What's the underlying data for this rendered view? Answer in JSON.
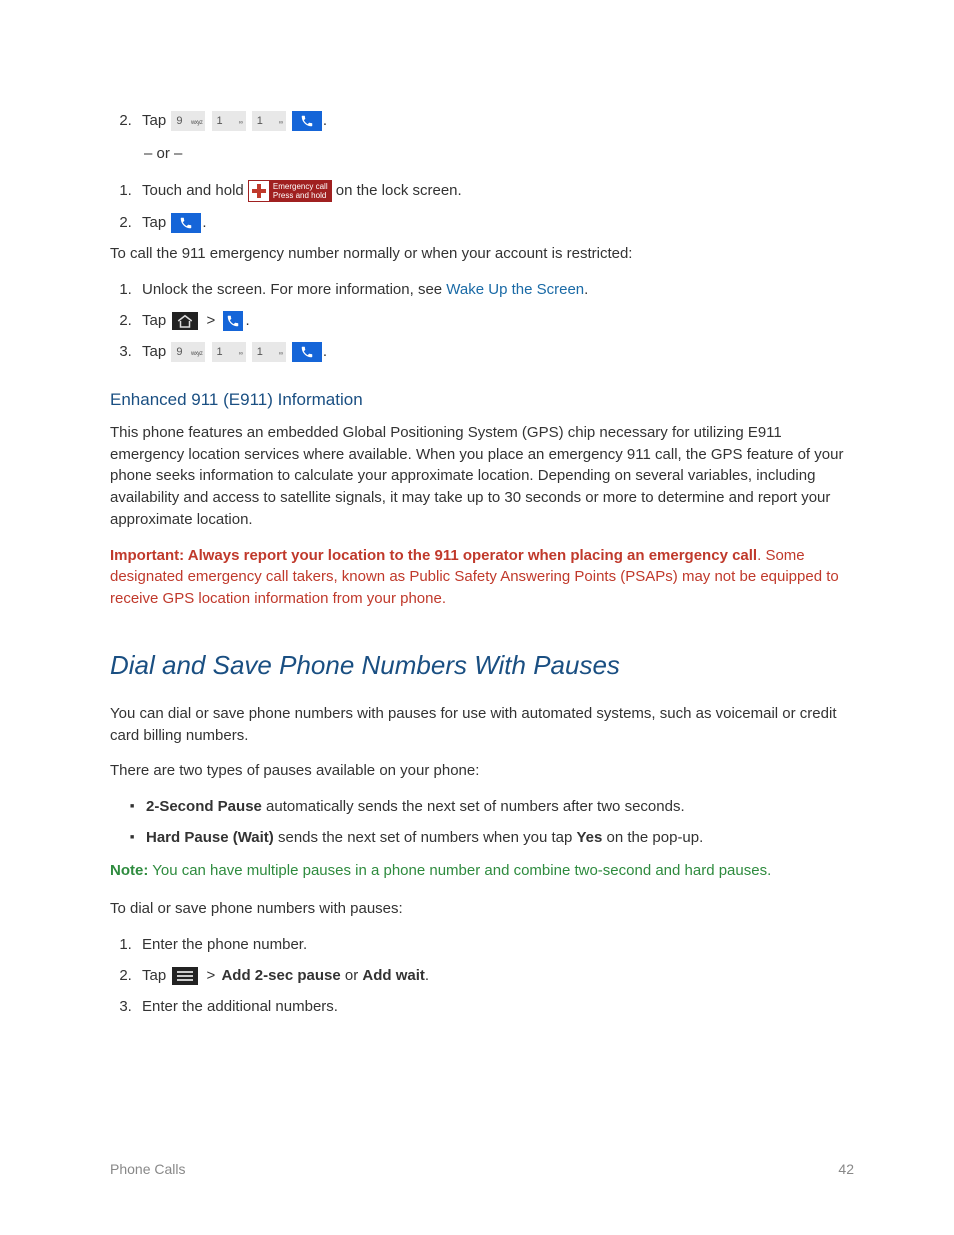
{
  "list1": {
    "item2_pre": "Tap ",
    "item2_post": "."
  },
  "or_text": "– or –",
  "list2": {
    "item1_pre": "Touch and hold ",
    "item1_post": " on the lock screen.",
    "emergency_top": "Emergency call",
    "emergency_bottom": "Press and hold",
    "item2_pre": "Tap ",
    "item2_post": "."
  },
  "para_restricted": "To call the 911 emergency number normally or when your account is restricted:",
  "list3": {
    "item1_pre": "Unlock the screen. For more information, see ",
    "item1_link": "Wake Up the Screen",
    "item1_post": ".",
    "item2_pre": "Tap ",
    "item2_gt": " > ",
    "item2_post": ".",
    "item3_pre": "Tap ",
    "item3_post": "."
  },
  "keys": {
    "k9": "9",
    "k9sup": "wxyz",
    "k1": "1",
    "k1sup": "∞"
  },
  "e911_heading": "Enhanced 911 (E911) Information",
  "e911_para": "This phone features an embedded Global Positioning System (GPS) chip necessary for utilizing E911 emergency location services where available. When you place an emergency 911 call, the GPS feature of your phone seeks information to calculate your approximate location. Depending on several variables, including availability and access to satellite signals, it may take up to 30 seconds or more to determine and report your approximate location.",
  "important_lead": "Important: Always report your location to the 911 operator when placing an emergency call",
  "important_tail": ". Some designated emergency call takers, known as Public Safety Answering Points (PSAPs) may not be equipped to receive GPS location information from your phone.",
  "pauses_heading": "Dial and Save Phone Numbers With Pauses",
  "pauses_para1": "You can dial or save phone numbers with pauses for use with automated systems, such as voicemail or credit card billing numbers.",
  "pauses_para2": "There are two types of pauses available on your phone:",
  "bullets": {
    "b1_bold": "2-Second Pause",
    "b1_tail": " automatically sends the next set of numbers after two seconds.",
    "b2_bold": "Hard Pause (Wait)",
    "b2_mid": " sends the next set of numbers when you tap ",
    "b2_yes": "Yes",
    "b2_tail": " on the pop-up."
  },
  "note_lead": "Note:",
  "note_tail": "  You can have multiple pauses in a phone number and combine two-second and hard pauses.",
  "pauses_para3": "To dial or save phone numbers with pauses:",
  "list4": {
    "item1": "Enter the phone number.",
    "item2_pre": "Tap ",
    "item2_gt": " > ",
    "item2_bold1": "Add 2-sec pause",
    "item2_or": " or ",
    "item2_bold2": "Add wait",
    "item2_post": ".",
    "item3": "Enter the additional numbers."
  },
  "footer_left": "Phone Calls",
  "footer_right": "42"
}
